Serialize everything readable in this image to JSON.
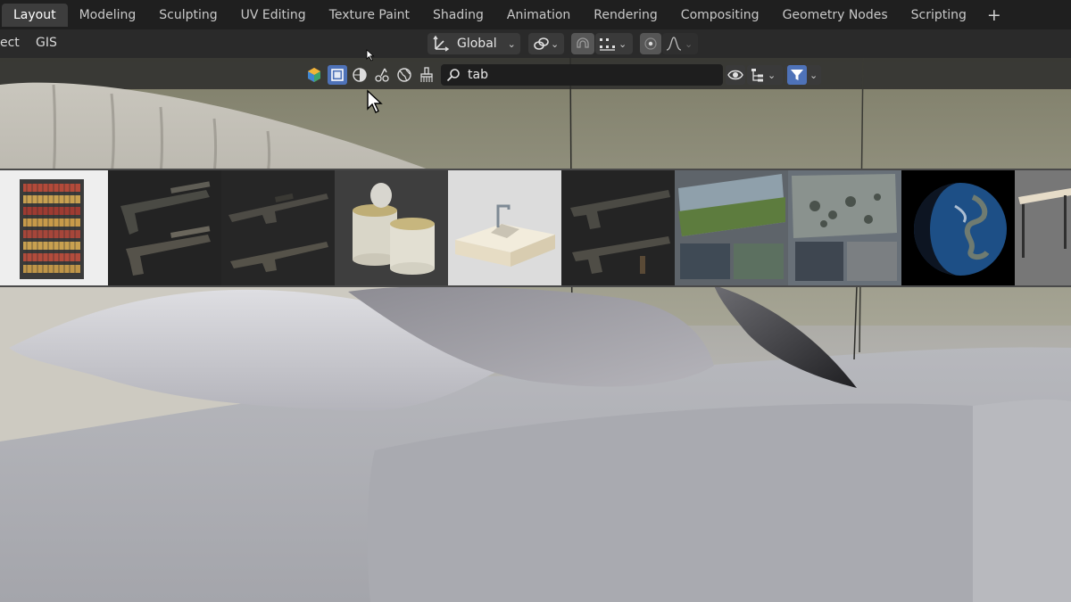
{
  "workspace_tabs": [
    {
      "label": "Layout",
      "active": true
    },
    {
      "label": "Modeling",
      "active": false
    },
    {
      "label": "Sculpting",
      "active": false
    },
    {
      "label": "UV Editing",
      "active": false
    },
    {
      "label": "Texture Paint",
      "active": false
    },
    {
      "label": "Shading",
      "active": false
    },
    {
      "label": "Animation",
      "active": false
    },
    {
      "label": "Rendering",
      "active": false
    },
    {
      "label": "Compositing",
      "active": false
    },
    {
      "label": "Geometry Nodes",
      "active": false
    },
    {
      "label": "Scripting",
      "active": false
    }
  ],
  "add_workspace_label": "+",
  "header": {
    "menu_select_partial": "ect",
    "menu_gis": "GIS",
    "transform_orientation": "Global"
  },
  "asset_search": {
    "query": "tab"
  },
  "icons": {
    "orientation": "transform-orientation-icon",
    "pivot": "link-pivot-icon",
    "snap": "snap-magnet-icon",
    "snap_target": "snap-increment-icon",
    "proportional": "proportional-editing-icon",
    "falloff": "falloff-curve-icon",
    "search": "search-icon",
    "visibility": "eye-icon",
    "outliner": "outliner-tree-icon",
    "filter": "filter-funnel-icon"
  },
  "colors": {
    "active_tab_bg": "#3d3d3d",
    "accent_blue": "#4e72b8",
    "topbar_bg": "#1f1f1f",
    "header_bg": "#2a2a2a"
  },
  "asset_thumbnails": [
    "bookshelf-thumbnail",
    "pistol-thumbnail",
    "rifle-thumbnail",
    "tin-cans-thumbnail",
    "sink-thumbnail",
    "weapons-thumbnail",
    "terrain-texture-thumbnail",
    "decal-pack-thumbnail",
    "earth-thumbnail",
    "table-thumbnail"
  ]
}
